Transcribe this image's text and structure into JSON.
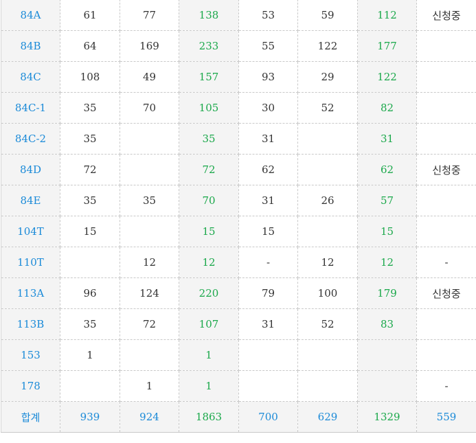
{
  "colors": {
    "accent_blue": "#1a8ad8",
    "accent_green": "#1aa84a",
    "cell_bg": "#f4f4f4"
  },
  "rows": [
    {
      "type": "84A",
      "c1": "61",
      "c2": "77",
      "sum1": "138",
      "c4": "53",
      "c5": "59",
      "sum2": "112",
      "note": "신청중"
    },
    {
      "type": "84B",
      "c1": "64",
      "c2": "169",
      "sum1": "233",
      "c4": "55",
      "c5": "122",
      "sum2": "177",
      "note": ""
    },
    {
      "type": "84C",
      "c1": "108",
      "c2": "49",
      "sum1": "157",
      "c4": "93",
      "c5": "29",
      "sum2": "122",
      "note": ""
    },
    {
      "type": "84C-1",
      "c1": "35",
      "c2": "70",
      "sum1": "105",
      "c4": "30",
      "c5": "52",
      "sum2": "82",
      "note": ""
    },
    {
      "type": "84C-2",
      "c1": "35",
      "c2": "",
      "sum1": "35",
      "c4": "31",
      "c5": "",
      "sum2": "31",
      "note": ""
    },
    {
      "type": "84D",
      "c1": "72",
      "c2": "",
      "sum1": "72",
      "c4": "62",
      "c5": "",
      "sum2": "62",
      "note": "신청중"
    },
    {
      "type": "84E",
      "c1": "35",
      "c2": "35",
      "sum1": "70",
      "c4": "31",
      "c5": "26",
      "sum2": "57",
      "note": ""
    },
    {
      "type": "104T",
      "c1": "15",
      "c2": "",
      "sum1": "15",
      "c4": "15",
      "c5": "",
      "sum2": "15",
      "note": ""
    },
    {
      "type": "110T",
      "c1": "",
      "c2": "12",
      "sum1": "12",
      "c4": "-",
      "c5": "12",
      "sum2": "12",
      "note": "-"
    },
    {
      "type": "113A",
      "c1": "96",
      "c2": "124",
      "sum1": "220",
      "c4": "79",
      "c5": "100",
      "sum2": "179",
      "note": "신청중"
    },
    {
      "type": "113B",
      "c1": "35",
      "c2": "72",
      "sum1": "107",
      "c4": "31",
      "c5": "52",
      "sum2": "83",
      "note": ""
    },
    {
      "type": "153",
      "c1": "1",
      "c2": "",
      "sum1": "1",
      "c4": "",
      "c5": "",
      "sum2": "",
      "note": ""
    },
    {
      "type": "178",
      "c1": "",
      "c2": "1",
      "sum1": "1",
      "c4": "",
      "c5": "",
      "sum2": "",
      "note": "-"
    }
  ],
  "total": {
    "type": "합계",
    "c1": "939",
    "c2": "924",
    "sum1": "1863",
    "c4": "700",
    "c5": "629",
    "sum2": "1329",
    "note": "559"
  }
}
